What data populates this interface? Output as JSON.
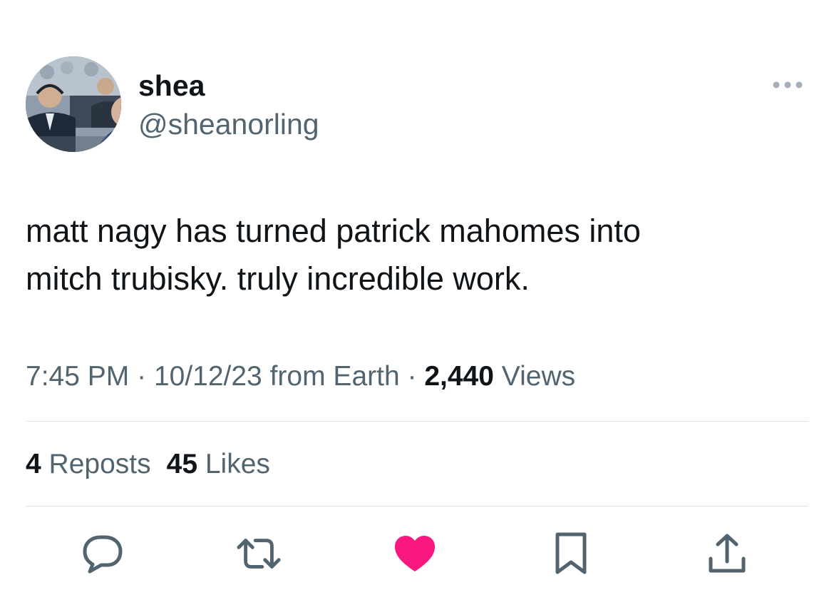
{
  "user": {
    "display_name": "shea",
    "handle": "@sheanorling",
    "avatar_icon": "profile-photo"
  },
  "tweet": {
    "text": "matt nagy has turned patrick mahomes into\nmitch trubisky. truly incredible work."
  },
  "meta": {
    "time": "7:45 PM",
    "date": "10/12/23",
    "source": "from Earth",
    "separator": "·",
    "views_count": "2,440",
    "views_label": "Views"
  },
  "stats": {
    "reposts_count": "4",
    "reposts_label": "Reposts",
    "likes_count": "45",
    "likes_label": "Likes"
  },
  "actions": {
    "reply_icon": "reply-icon",
    "repost_icon": "repost-icon",
    "like_icon": "heart-icon",
    "like_color": "#f91880",
    "bookmark_icon": "bookmark-icon",
    "share_icon": "share-icon"
  },
  "colors": {
    "primary_text": "#0f1419",
    "secondary_text": "#536471",
    "divider": "#dde3e8"
  }
}
